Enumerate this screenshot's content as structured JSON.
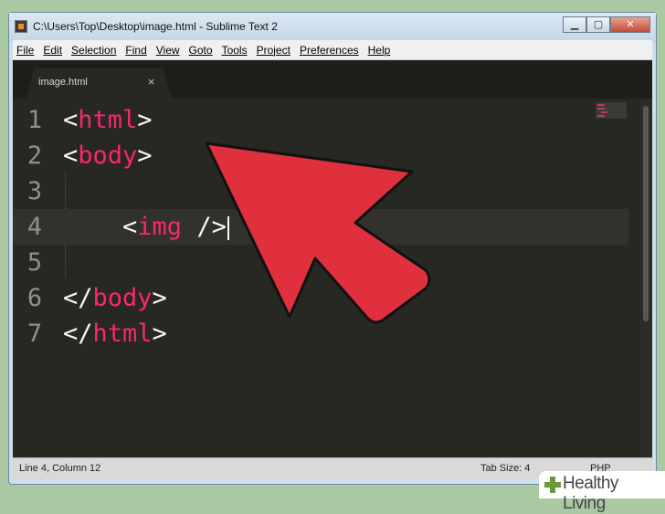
{
  "window": {
    "title": "C:\\Users\\Top\\Desktop\\image.html - Sublime Text 2",
    "controls": {
      "minimize": "▁",
      "maximize": "▢",
      "close": "✕"
    }
  },
  "menu": [
    "File",
    "Edit",
    "Selection",
    "Find",
    "View",
    "Goto",
    "Tools",
    "Project",
    "Preferences",
    "Help"
  ],
  "tab": {
    "label": "image.html",
    "close": "×"
  },
  "lines": [
    {
      "number": "1",
      "open": "<",
      "tag": "html",
      "close": ">",
      "indent": ""
    },
    {
      "number": "2",
      "open": "<",
      "tag": "body",
      "close": ">",
      "indent": ""
    },
    {
      "number": "3",
      "open": "",
      "tag": "",
      "close": "",
      "indent": ""
    },
    {
      "number": "4",
      "open": "<",
      "tag": "img",
      "close": " />",
      "indent": "    "
    },
    {
      "number": "5",
      "open": "",
      "tag": "",
      "close": "",
      "indent": ""
    },
    {
      "number": "6",
      "open": "</",
      "tag": "body",
      "close": ">",
      "indent": ""
    },
    {
      "number": "7",
      "open": "</",
      "tag": "html",
      "close": ">",
      "indent": ""
    }
  ],
  "status": {
    "position": "Line 4, Column 12",
    "tab_size": "Tab Size: 4",
    "syntax": "PHP"
  },
  "colors": {
    "editor_bg": "#272822",
    "tag": "#f92672",
    "arrow": "#e0303e"
  },
  "watermark": {
    "text": "Healthy Living"
  }
}
